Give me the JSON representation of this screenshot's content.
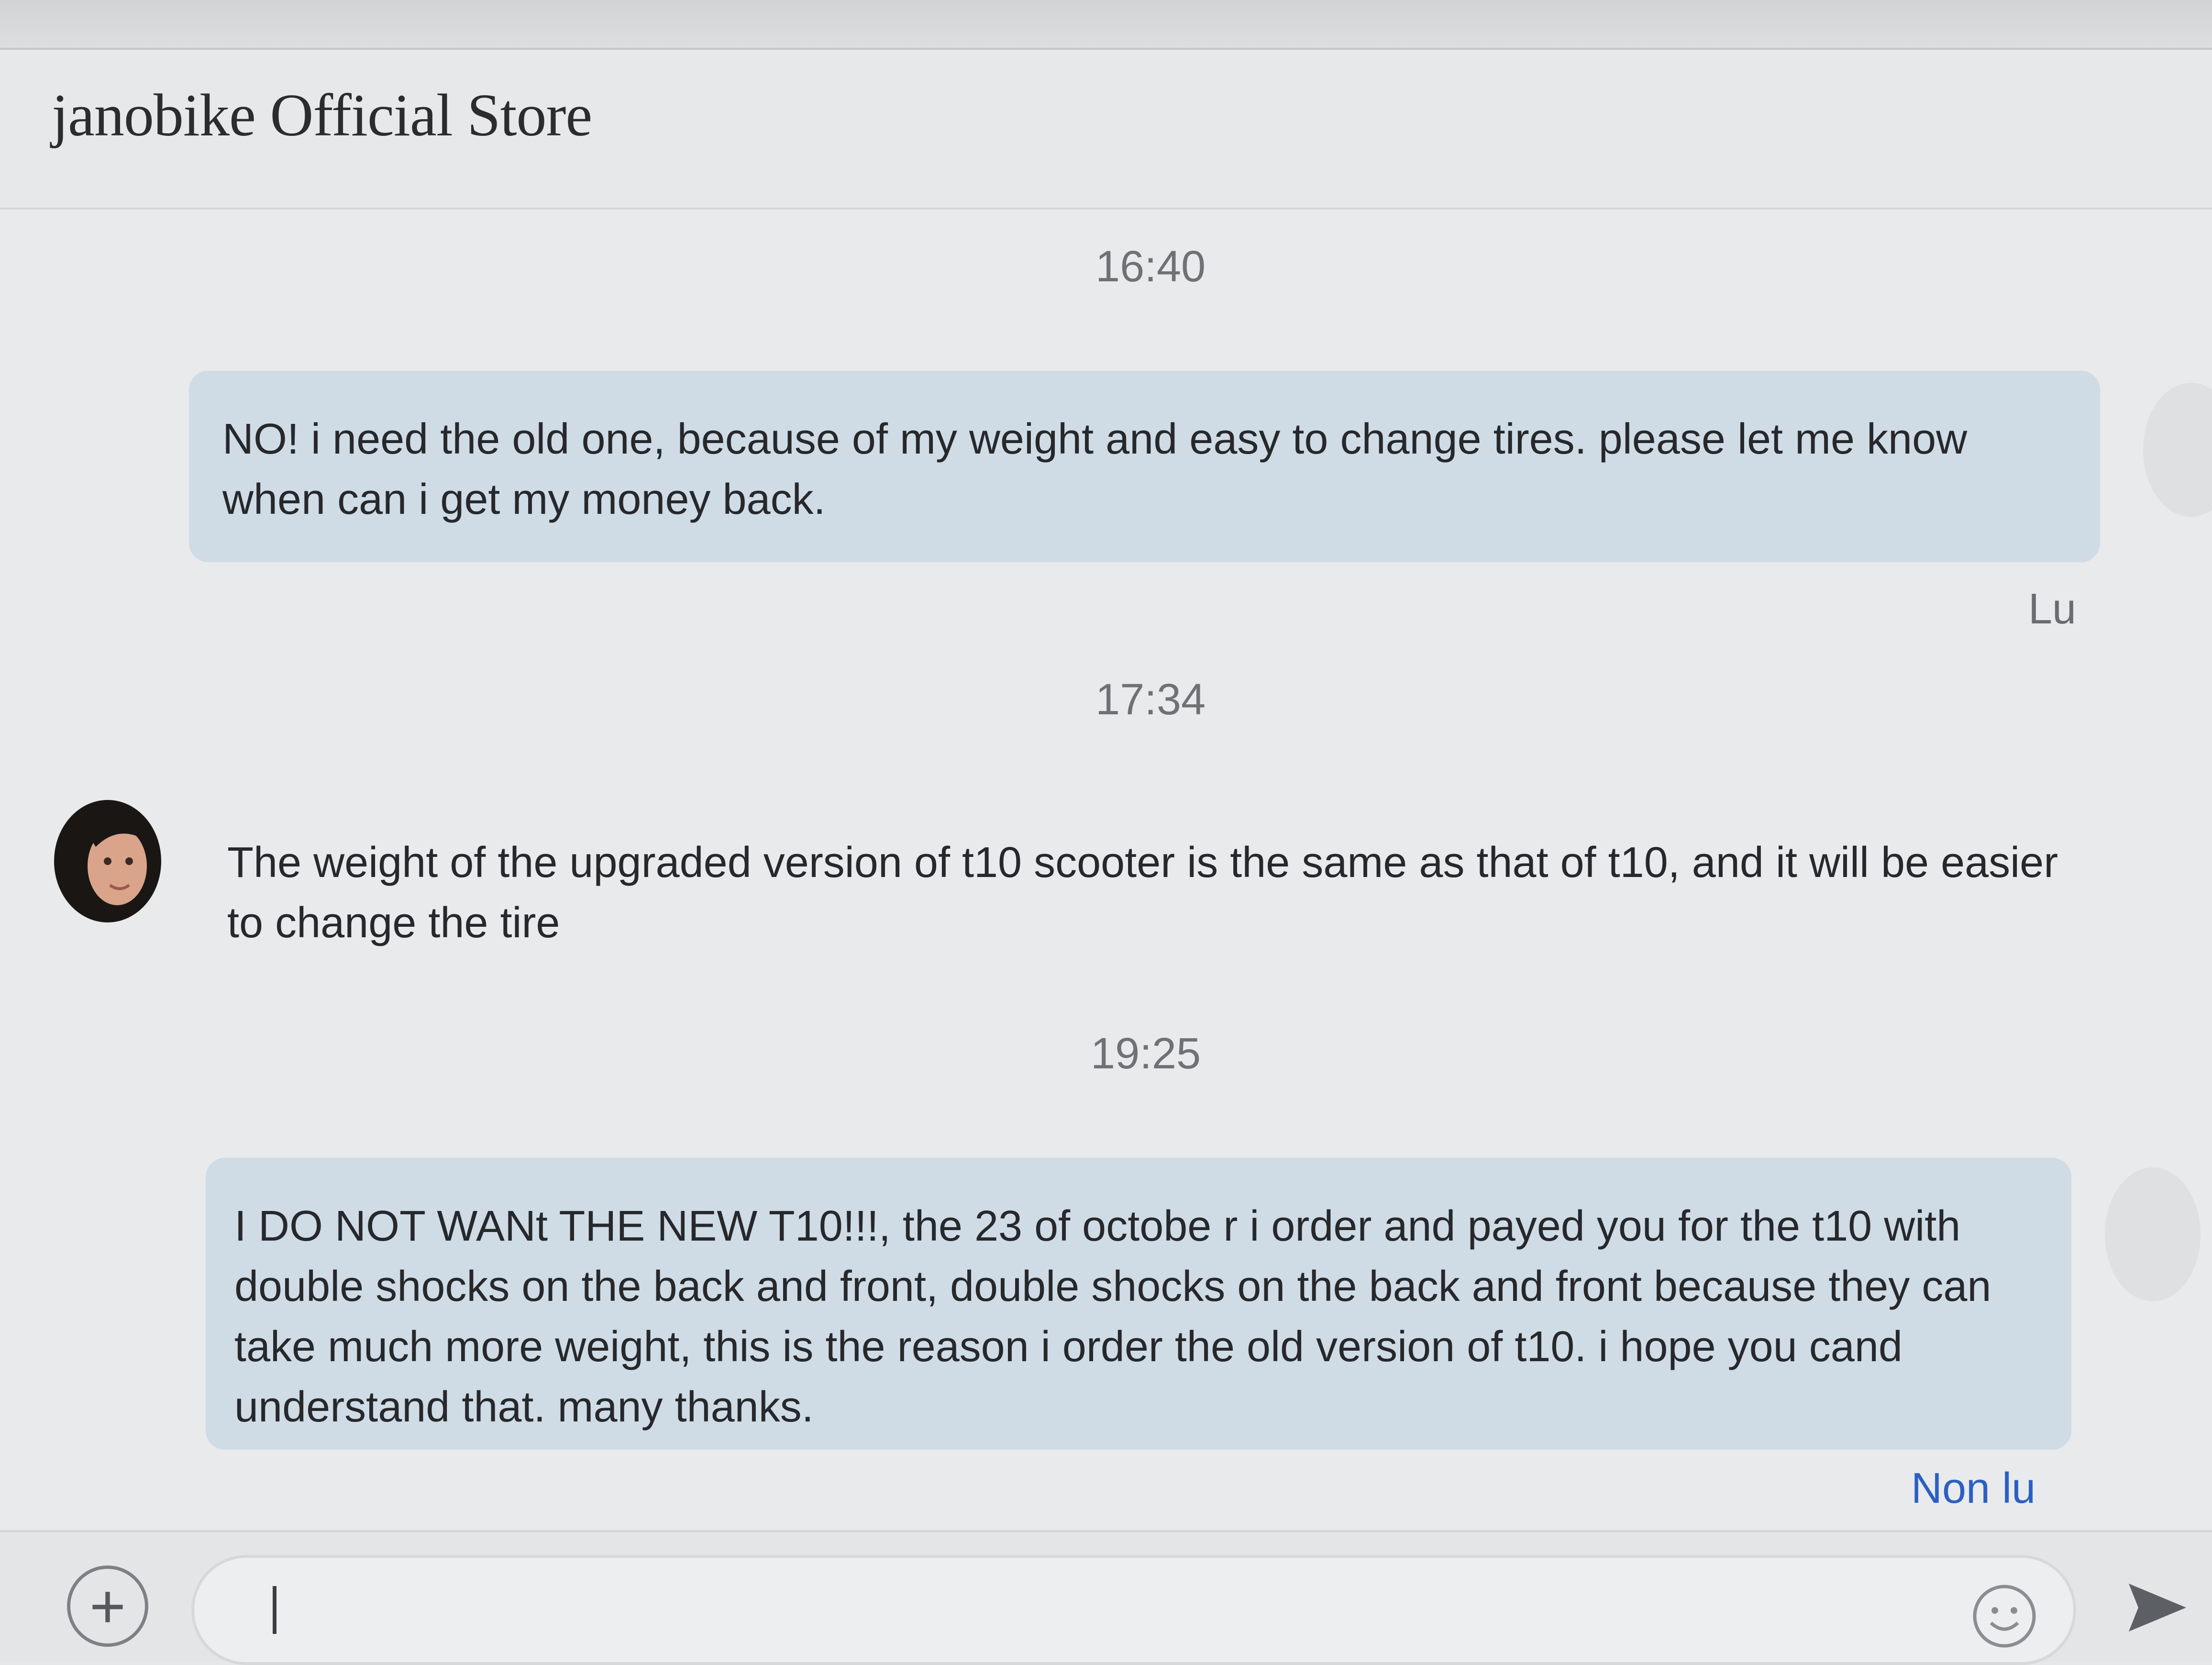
{
  "header": {
    "title": "janobike Official Store"
  },
  "messages": [
    {
      "time": "16:40",
      "text": "NO! i need the old one, because of my weight and easy to change tires. please let me know when can i get my money back.",
      "status": "Lu"
    },
    {
      "time": "17:34",
      "text": "The weight of the upgraded version of t10 scooter is the same as that of t10, and it will be easier to change the tire"
    },
    {
      "time": "19:25",
      "text": "I DO NOT WANt THE NEW T10!!!, the 23 of octobe r i order and payed you for the t10 with double shocks on the back and front, double shocks on the back and front because they can take much more weight, this is the reason i order the old version of t10. i hope you cand understand that. many thanks.",
      "status": "Non lu"
    }
  ],
  "composer": {
    "input_value": "",
    "plus_icon": "plus-icon",
    "emoji_icon": "smiley-icon",
    "send_icon": "send-icon"
  },
  "colors": {
    "outgoing_bubble": "#cfdbe5",
    "unread_status": "#2b5fc4",
    "read_status": "#6a6c70",
    "background": "#e9eaeb"
  }
}
